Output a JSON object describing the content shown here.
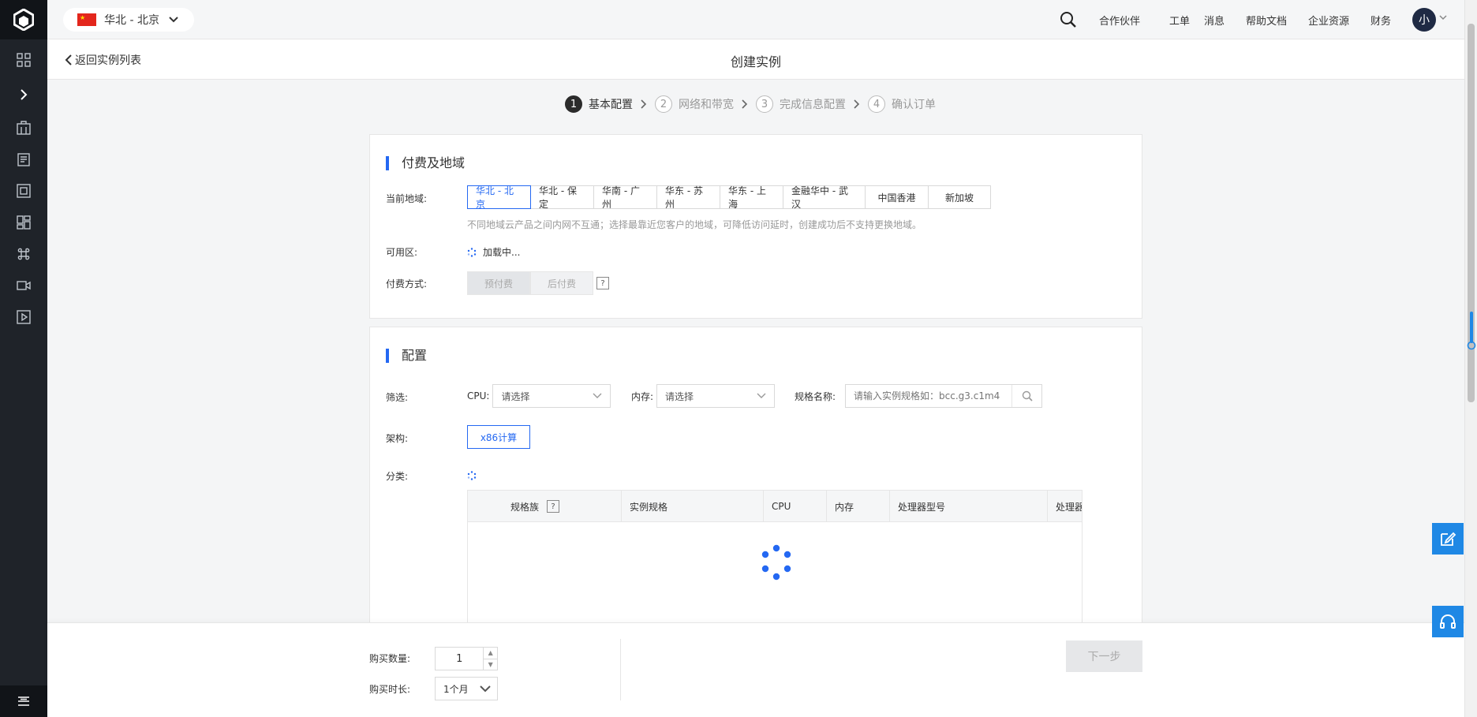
{
  "header": {
    "region": "华北 - 北京",
    "nav": [
      "合作伙伴",
      "工单",
      "消息",
      "帮助文档",
      "企业资源",
      "财务"
    ],
    "avatar_text": "小"
  },
  "subbar": {
    "back_label": "返回实例列表",
    "title": "创建实例"
  },
  "steps": [
    {
      "num": "1",
      "label": "基本配置",
      "active": true
    },
    {
      "num": "2",
      "label": "网络和带宽",
      "active": false
    },
    {
      "num": "3",
      "label": "完成信息配置",
      "active": false
    },
    {
      "num": "4",
      "label": "确认订单",
      "active": false
    }
  ],
  "billing": {
    "title": "付费及地域",
    "region_label": "当前地域:",
    "regions": [
      "华北 - 北京",
      "华北 - 保定",
      "华南 - 广州",
      "华东 - 苏州",
      "华东 - 上海",
      "金融华中 - 武汉",
      "中国香港",
      "新加坡"
    ],
    "selected_region": "华北 - 北京",
    "region_hint": "不同地域云产品之间内网不互通；选择最靠近您客户的地域，可降低访问延时，创建成功后不支持更换地域。",
    "zone_label": "可用区:",
    "zone_loading": "加载中...",
    "pay_label": "付费方式:",
    "pay_options": [
      "预付费",
      "后付费"
    ],
    "pay_help": "?"
  },
  "config": {
    "title": "配置",
    "filter_label": "筛选:",
    "cpu_label": "CPU:",
    "cpu_placeholder": "请选择",
    "mem_label": "内存:",
    "mem_placeholder": "请选择",
    "spec_name_label": "规格名称:",
    "spec_search_placeholder": "请输入实例规格如：bcc.g3.c1m4",
    "arch_label": "架构:",
    "arch_option": "x86计算",
    "category_label": "分类:",
    "table_columns": [
      "规格族",
      "实例规格",
      "CPU",
      "内存",
      "处理器型号",
      "处理器"
    ],
    "family_help": "?"
  },
  "bottom": {
    "qty_label": "购买数量:",
    "qty_value": "1",
    "duration_label": "购买时长:",
    "duration_value": "1个月",
    "next_label": "下一步"
  },
  "colors": {
    "accent": "#2468f2",
    "float_button": "#1f88e5",
    "sidebar": "#1f2329"
  }
}
